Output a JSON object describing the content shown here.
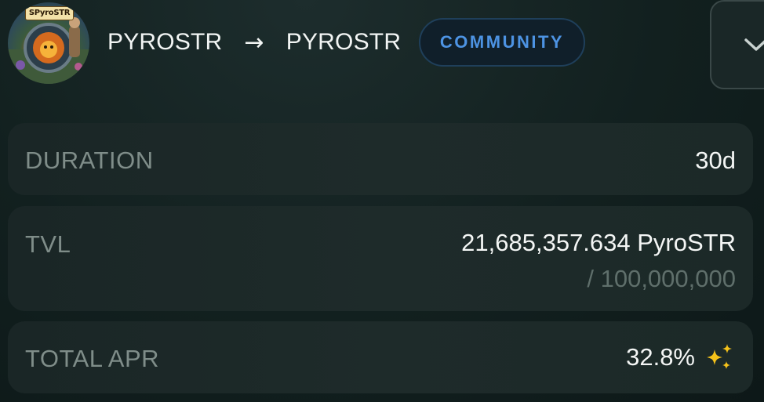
{
  "header": {
    "avatar_label": "SPyroSTR",
    "from_token": "PYROSTR",
    "arrow": "→",
    "to_token": "PYROSTR",
    "badge": "COMMUNITY",
    "dropdown_icon": "chevron-down-icon"
  },
  "rows": {
    "duration": {
      "label": "DURATION",
      "value": "30d"
    },
    "tvl": {
      "label": "TVL",
      "value": "21,685,357.634 PyroSTR",
      "cap": "/ 100,000,000"
    },
    "apr": {
      "label": "TOTAL APR",
      "value": "32.8%",
      "icon": "sparkle-icon"
    }
  },
  "colors": {
    "badge_text": "#4d93e3",
    "sparkle": "#f5c21a",
    "label": "#7f8d89",
    "value": "#f4f6f5"
  }
}
